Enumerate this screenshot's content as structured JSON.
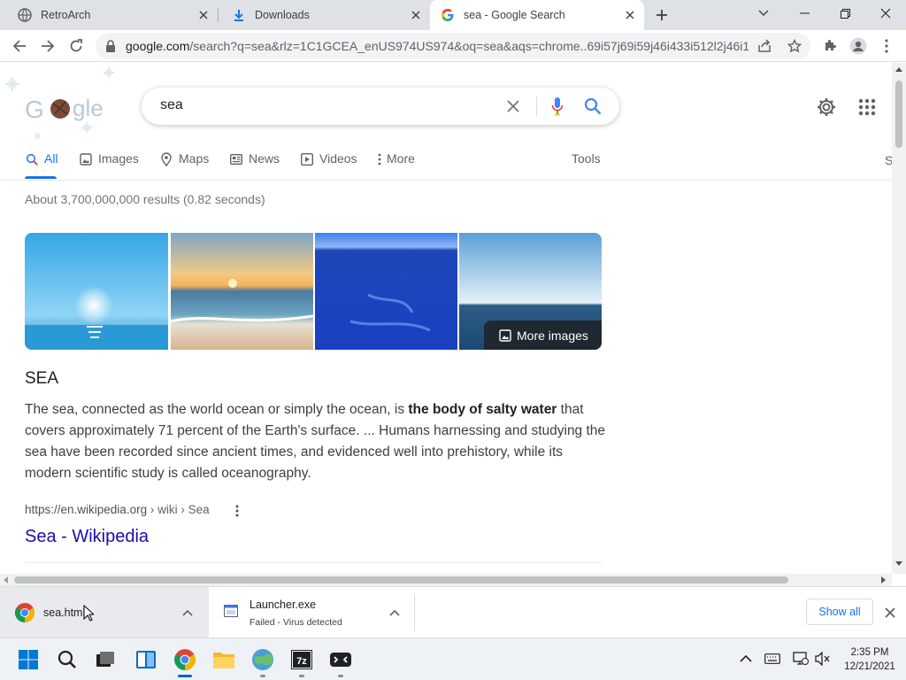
{
  "tabs": [
    {
      "title": "RetroArch",
      "active": false
    },
    {
      "title": "Downloads",
      "active": false
    },
    {
      "title": "sea - Google Search",
      "active": true
    }
  ],
  "omnibox": {
    "host": "google.com",
    "path": "/search?q=sea&rlz=1C1GCEA_enUS974US974&oq=sea&aqs=chrome..69i57j69i59j46i433i512l2j46i1..."
  },
  "search": {
    "query": "sea"
  },
  "nav_tabs": [
    "All",
    "Images",
    "Maps",
    "News",
    "Videos",
    "More"
  ],
  "tools_label": "Tools",
  "stats": "About 3,700,000,000 results (0.82 seconds)",
  "images": {
    "more_label": "More images"
  },
  "knowledge": {
    "title": "SEA",
    "desc_pre": "The sea, connected as the world ocean or simply the ocean, is ",
    "desc_bold": "the body of salty water",
    "desc_post": " that covers approximately 71 percent of the Earth's surface. ... Humans harnessing and studying the sea have been recorded since ancient times, and evidenced well into prehistory, while its modern scientific study is called oceanography."
  },
  "source": {
    "url": "https://en.wikipedia.org",
    "crumb": " › wiki › Sea",
    "title": "Sea - Wikipedia"
  },
  "downloads": [
    {
      "name": "sea.html",
      "status": ""
    },
    {
      "name": "Launcher.exe",
      "status": "Failed - Virus detected"
    }
  ],
  "shelf": {
    "show_all": "Show all"
  },
  "clock": {
    "time": "2:35 PM",
    "date": "12/21/2021"
  },
  "colors": {
    "accent": "#1a73e8",
    "link": "#1a0dab",
    "tab_strip": "#dee1e6"
  }
}
